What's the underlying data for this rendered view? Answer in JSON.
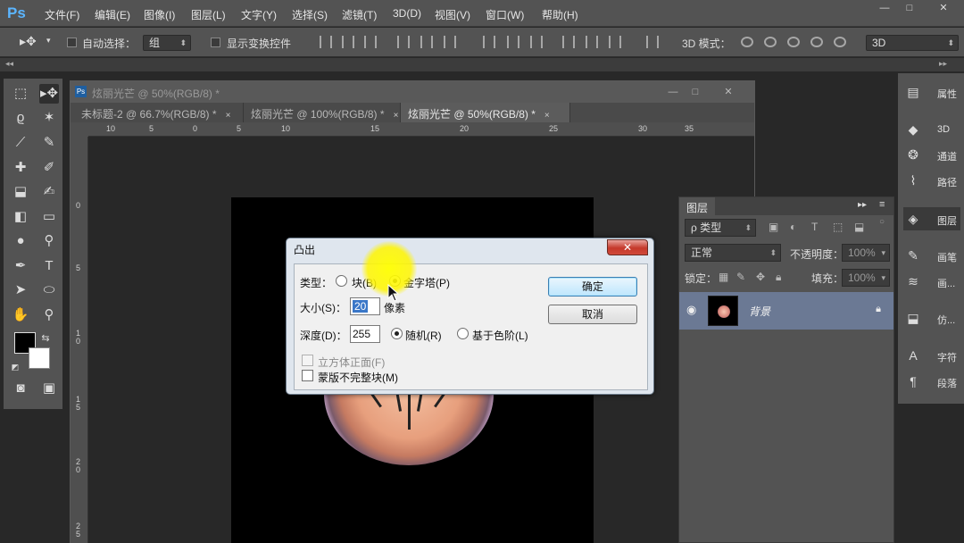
{
  "app": {
    "logo": "Ps"
  },
  "menu": [
    "文件(F)",
    "编辑(E)",
    "图像(I)",
    "图层(L)",
    "文字(Y)",
    "选择(S)",
    "滤镜(T)",
    "3D(D)",
    "视图(V)",
    "窗口(W)",
    "帮助(H)"
  ],
  "window_controls": [
    "—",
    "□",
    "✕"
  ],
  "options": {
    "auto_select_label": "自动选择：",
    "auto_select_value": "组",
    "show_transform_label": "显示变换控件",
    "mode_3d_label": "3D 模式：",
    "workspace_value": "3D"
  },
  "toolbox": {
    "tools": [
      "marquee-tool",
      "move-tool",
      "lasso-tool",
      "magic-wand-tool",
      "eyedropper-tool",
      "brush-tool",
      "healing-tool",
      "pencil-tool",
      "stamp-tool",
      "history-brush-tool",
      "eraser-tool",
      "gradient-tool",
      "blur-tool",
      "dodge-tool",
      "pen-tool",
      "type-tool",
      "path-select-tool",
      "ellipse-tool",
      "hand-tool",
      "zoom-tool"
    ],
    "type_tool_glyph": "T",
    "foreground_color": "#000000",
    "background_color": "#ffffff"
  },
  "document": {
    "title": "炫丽光芒 @ 50%(RGB/8) *",
    "tabs": [
      {
        "label": "未标题-2 @ 66.7%(RGB/8) *",
        "close": "×",
        "active": false
      },
      {
        "label": "炫丽光芒 @ 100%(RGB/8) *",
        "close": "×",
        "active": false
      },
      {
        "label": "炫丽光芒 @ 50%(RGB/8) *",
        "close": "×",
        "active": true
      }
    ],
    "hruler_ticks": [
      "10",
      "5",
      "0",
      "5",
      "10",
      "15",
      "20",
      "25",
      "30",
      "35"
    ],
    "vruler_ticks": [
      "0",
      "5",
      "1 0",
      "1 5",
      "2 0",
      "2 5"
    ]
  },
  "right_dock": [
    {
      "icon": "properties-icon",
      "label": "属性"
    },
    {
      "icon": "cube-icon",
      "label": "3D"
    },
    {
      "icon": "channels-icon",
      "label": "通道"
    },
    {
      "icon": "paths-icon",
      "label": "路径"
    },
    {
      "icon": "layers-icon",
      "label": "图层",
      "selected": true
    },
    {
      "icon": "brush-icon",
      "label": "画笔"
    },
    {
      "icon": "brush-presets-icon",
      "label": "画..."
    },
    {
      "icon": "clone-source-icon",
      "label": "仿..."
    },
    {
      "icon": "character-icon",
      "label": "字符"
    },
    {
      "icon": "paragraph-icon",
      "label": "段落"
    }
  ],
  "layers_panel": {
    "tab": "图层",
    "filter_value": "ρ 类型",
    "blend_mode": "正常",
    "opacity_label": "不透明度：",
    "opacity_value": "100%",
    "lock_label": "锁定：",
    "fill_label": "填充：",
    "fill_value": "100%",
    "layer_name": "背景"
  },
  "dialog": {
    "title": "凸出",
    "close": "✕",
    "type_label": "类型：",
    "type_block": "块(B)",
    "type_pyramid": "金字塔(P)",
    "size_label": "大小(S)：",
    "size_value": "20",
    "size_unit": "像素",
    "depth_label": "深度(D)：",
    "depth_value": "255",
    "depth_random": "随机(R)",
    "depth_level": "基于色阶(L)",
    "solid_front": "立方体正面(F)",
    "mask_incomplete": "蒙版不完整块(M)",
    "ok": "确定",
    "cancel": "取消"
  }
}
